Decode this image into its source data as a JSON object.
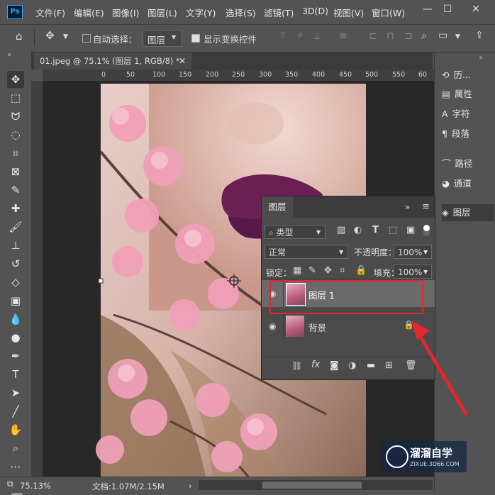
{
  "menubar": {
    "logo": "Ps",
    "items": [
      "文件(F)",
      "编辑(E)",
      "图像(I)",
      "图层(L)",
      "文字(Y)",
      "选择(S)",
      "滤镜(T)",
      "3D(D)",
      "视图(V)",
      "窗口(W)"
    ]
  },
  "options": {
    "auto_select_label": "自动选择：",
    "layer_select_value": "图层",
    "show_transform_label": "显示变换控件"
  },
  "document": {
    "tab_title": "01.jpeg @ 75.1% (图层 1, RGB/8) *",
    "ruler_labels": [
      "0",
      "50",
      "100",
      "150",
      "200",
      "250",
      "300",
      "350",
      "400",
      "450",
      "500",
      "550",
      "60"
    ]
  },
  "right_panel": {
    "items": [
      "历...",
      "属性",
      "字符",
      "段落",
      "路径",
      "通道",
      "图层"
    ]
  },
  "layers_panel": {
    "tab": "图层",
    "filter_type": "类型",
    "blend_mode": "正常",
    "opacity_label": "不透明度：",
    "opacity_value": "100%",
    "lock_label": "锁定：",
    "fill_label": "填充：",
    "fill_value": "100%",
    "layers": [
      {
        "name": "图层 1"
      },
      {
        "name": "背景"
      }
    ]
  },
  "status": {
    "zoom": "75.13%",
    "doc_info": "文档:1.07M/2.15M"
  },
  "watermark": {
    "brand": "溜溜自学",
    "url": "ZIXUE.3D66.COM"
  },
  "colors": {
    "highlight_box": "#e0282e",
    "arrow": "#e0282e"
  }
}
